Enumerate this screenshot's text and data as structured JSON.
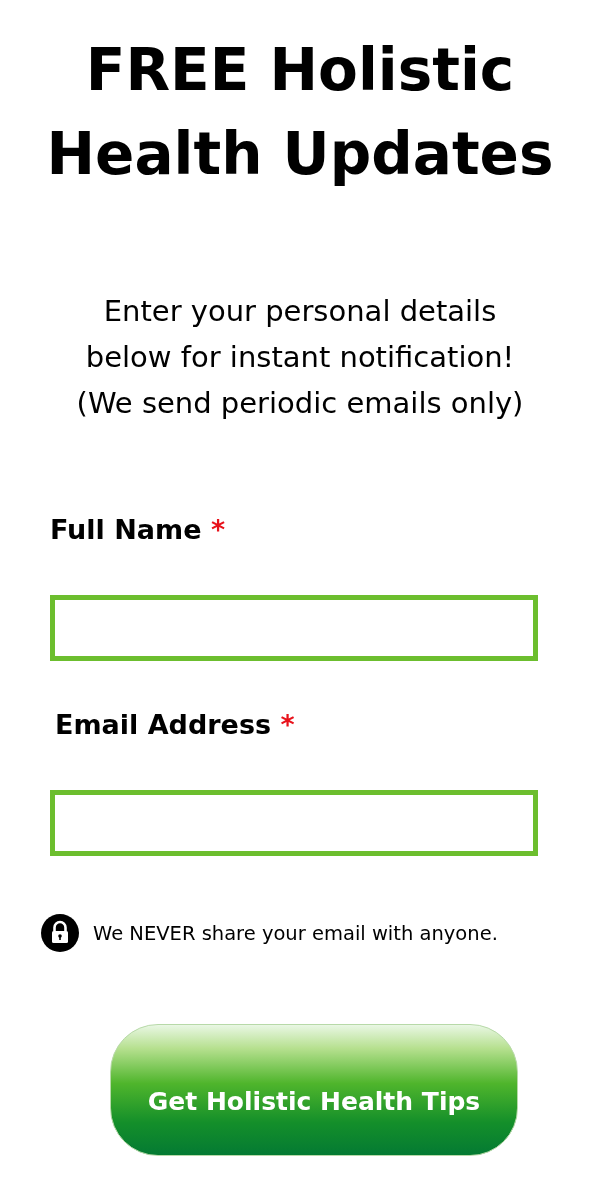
{
  "title": "FREE Holistic Health Updates",
  "intro": [
    "Enter your personal details",
    "below for instant notification!",
    "(We send periodic emails only)"
  ],
  "fields": [
    {
      "label": "Full Name",
      "required_mark": "*"
    },
    {
      "label": "Email Address",
      "required_mark": "*"
    }
  ],
  "privacy_note": "We NEVER share your email with anyone.",
  "submit_button": "Get Holistic Health Tips"
}
